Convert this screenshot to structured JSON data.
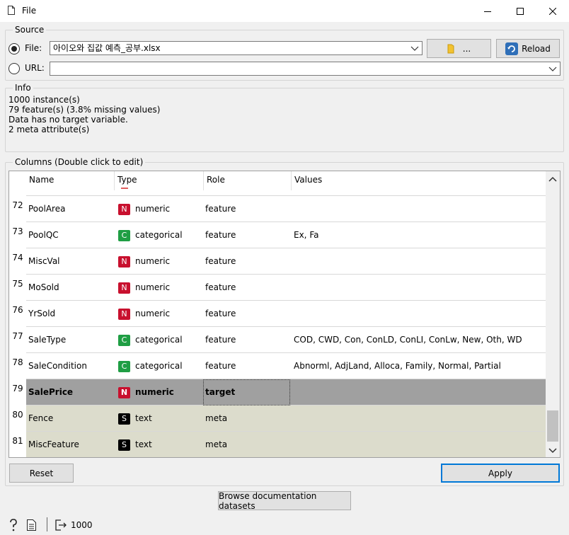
{
  "window": {
    "title": "File"
  },
  "source": {
    "group_title": "Source",
    "file_label": "File:",
    "file_value": "아이오와 집값 예측_공부.xlsx",
    "browse_label": "...",
    "reload_label": "Reload",
    "url_label": "URL:",
    "url_value": ""
  },
  "info": {
    "group_title": "Info",
    "lines": [
      "1000 instance(s)",
      "79 feature(s) (3.8% missing values)",
      "Data has no target variable.",
      "2 meta attribute(s)"
    ]
  },
  "columns": {
    "group_title": "Columns (Double click to edit)",
    "headers": [
      "Name",
      "Type",
      "Role",
      "Values"
    ],
    "rows": [
      {
        "num": "72",
        "name": "PoolArea",
        "badge": "N",
        "type": "numeric",
        "role": "feature",
        "values": ""
      },
      {
        "num": "73",
        "name": "PoolQC",
        "badge": "C",
        "type": "categorical",
        "role": "feature",
        "values": "Ex, Fa"
      },
      {
        "num": "74",
        "name": "MiscVal",
        "badge": "N",
        "type": "numeric",
        "role": "feature",
        "values": ""
      },
      {
        "num": "75",
        "name": "MoSold",
        "badge": "N",
        "type": "numeric",
        "role": "feature",
        "values": ""
      },
      {
        "num": "76",
        "name": "YrSold",
        "badge": "N",
        "type": "numeric",
        "role": "feature",
        "values": ""
      },
      {
        "num": "77",
        "name": "SaleType",
        "badge": "C",
        "type": "categorical",
        "role": "feature",
        "values": "COD, CWD, Con, ConLD, ConLI, ConLw, New, Oth, WD"
      },
      {
        "num": "78",
        "name": "SaleCondition",
        "badge": "C",
        "type": "categorical",
        "role": "feature",
        "values": "Abnorml, AdjLand, Alloca, Family, Normal, Partial"
      },
      {
        "num": "79",
        "name": "SalePrice",
        "badge": "N",
        "type": "numeric",
        "role": "target",
        "values": ""
      },
      {
        "num": "80",
        "name": "Fence",
        "badge": "S",
        "type": "text",
        "role": "meta",
        "values": ""
      },
      {
        "num": "81",
        "name": "MiscFeature",
        "badge": "S",
        "type": "text",
        "role": "meta",
        "values": ""
      }
    ]
  },
  "buttons": {
    "reset_label": "Reset",
    "apply_label": "Apply",
    "browse_docs_label": "Browse documentation datasets"
  },
  "status": {
    "output_count": "1000"
  },
  "colors": {
    "numeric": "#c8102e",
    "categorical": "#1f9e44",
    "text": "#000000",
    "accent": "#0078d7"
  }
}
